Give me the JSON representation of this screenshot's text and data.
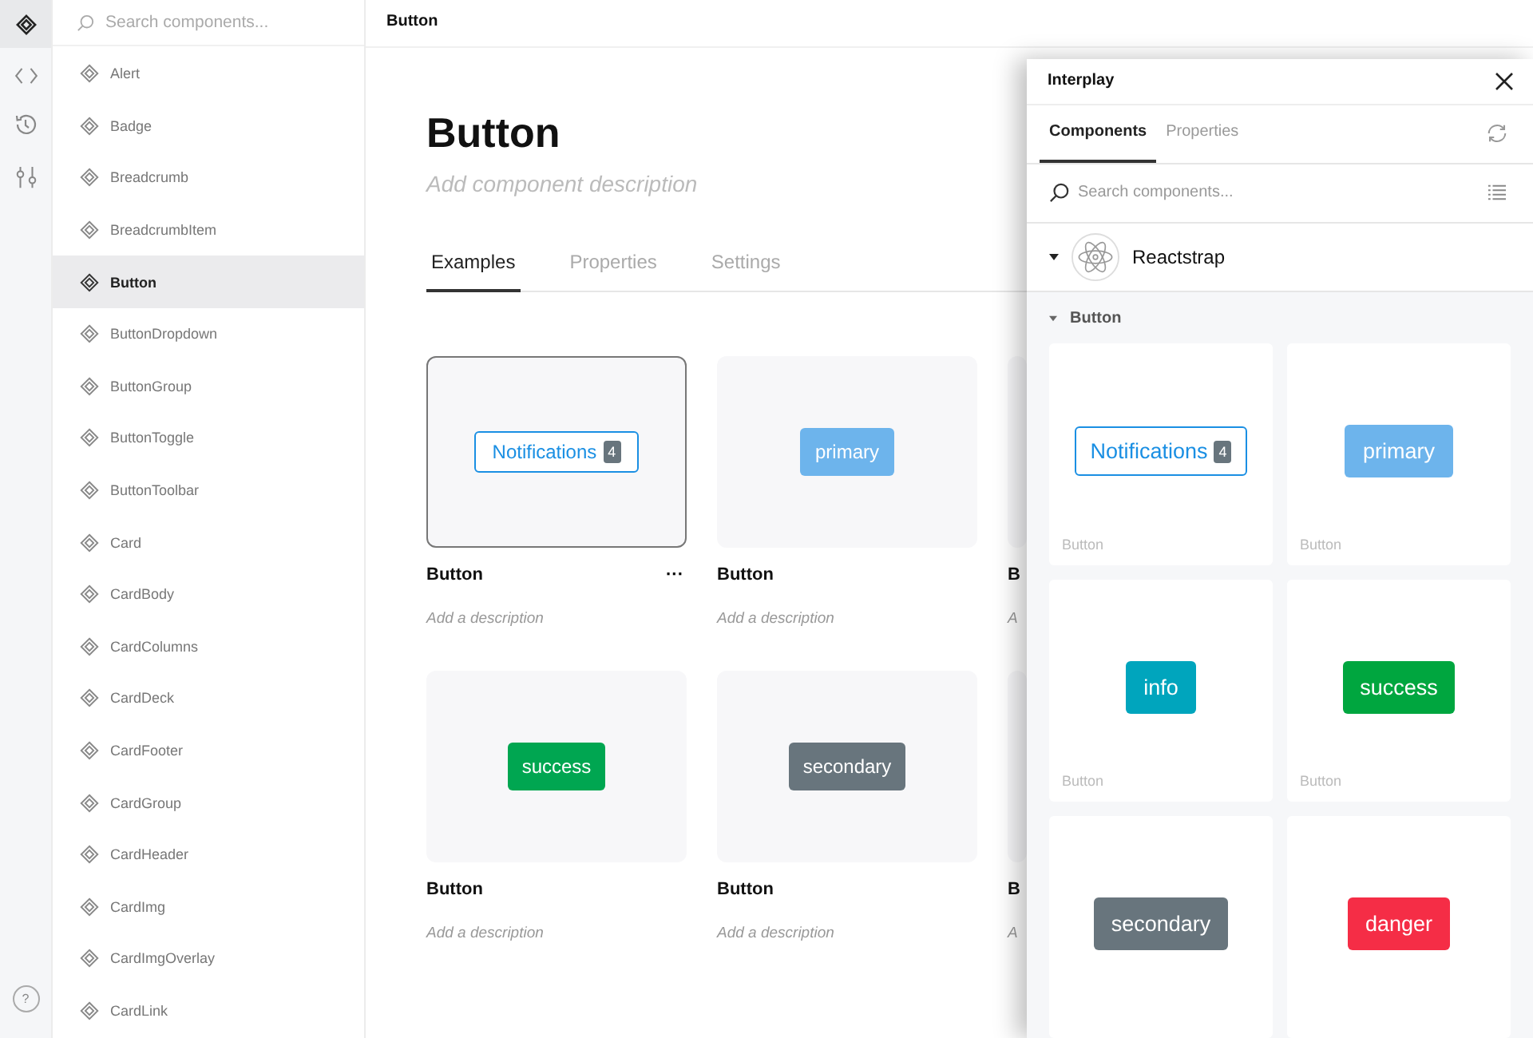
{
  "sidebar": {
    "search": {
      "placeholder": "Search components..."
    },
    "items": [
      {
        "label": "Alert",
        "selected": false
      },
      {
        "label": "Badge",
        "selected": false
      },
      {
        "label": "Breadcrumb",
        "selected": false
      },
      {
        "label": "BreadcrumbItem",
        "selected": false
      },
      {
        "label": "Button",
        "selected": true
      },
      {
        "label": "ButtonDropdown",
        "selected": false
      },
      {
        "label": "ButtonGroup",
        "selected": false
      },
      {
        "label": "ButtonToggle",
        "selected": false
      },
      {
        "label": "ButtonToolbar",
        "selected": false
      },
      {
        "label": "Card",
        "selected": false
      },
      {
        "label": "CardBody",
        "selected": false
      },
      {
        "label": "CardColumns",
        "selected": false
      },
      {
        "label": "CardDeck",
        "selected": false
      },
      {
        "label": "CardFooter",
        "selected": false
      },
      {
        "label": "CardGroup",
        "selected": false
      },
      {
        "label": "CardHeader",
        "selected": false
      },
      {
        "label": "CardImg",
        "selected": false
      },
      {
        "label": "CardImgOverlay",
        "selected": false
      },
      {
        "label": "CardLink",
        "selected": false
      }
    ]
  },
  "rail": {
    "help": "?"
  },
  "main": {
    "breadcrumb": "Button",
    "title": "Button",
    "description": "Add component description",
    "tabs": [
      {
        "label": "Examples",
        "selected": true
      },
      {
        "label": "Properties",
        "selected": false
      },
      {
        "label": "Settings",
        "selected": false
      }
    ],
    "examples": [
      {
        "title": "Button",
        "description": "Add a description",
        "selected": true,
        "menu": "···",
        "button": {
          "kind": "outline-badge",
          "label": "Notifications",
          "badge": "4",
          "color": "#1a8fe3"
        }
      },
      {
        "title": "Button",
        "description": "Add a description",
        "selected": false,
        "button": {
          "kind": "solid",
          "label": "primary",
          "color": "#6db4ec"
        }
      },
      {
        "title": "B",
        "description": "A",
        "selected": false
      },
      {
        "title": "Button",
        "description": "Add a description",
        "selected": false,
        "button": {
          "kind": "solid",
          "label": "success",
          "color": "#00a651"
        }
      },
      {
        "title": "Button",
        "description": "Add a description",
        "selected": false,
        "button": {
          "kind": "solid",
          "label": "secondary",
          "color": "#68757d"
        }
      },
      {
        "title": "B",
        "description": "A",
        "selected": false
      }
    ]
  },
  "panel": {
    "title": "Interplay",
    "tabs": [
      {
        "label": "Components",
        "selected": true
      },
      {
        "label": "Properties",
        "selected": false
      }
    ],
    "search": {
      "placeholder": "Search components..."
    },
    "library": {
      "name": "Reactstrap",
      "expanded": true
    },
    "section": {
      "name": "Button",
      "expanded": true
    },
    "cards": [
      {
        "label": "Button",
        "button": {
          "kind": "outline-badge",
          "label": "Notifications",
          "badge": "4",
          "color": "#1a8fe3"
        }
      },
      {
        "label": "Button",
        "button": {
          "kind": "solid",
          "label": "primary",
          "color": "#6db4ec"
        }
      },
      {
        "label": "Button",
        "button": {
          "kind": "solid",
          "label": "info",
          "color": "#00a5bd"
        }
      },
      {
        "label": "Button",
        "button": {
          "kind": "solid",
          "label": "success",
          "color": "#00a63f"
        }
      },
      {
        "button": {
          "kind": "solid",
          "label": "secondary",
          "color": "#68757d"
        }
      },
      {
        "button": {
          "kind": "solid",
          "label": "danger",
          "color": "#f52d46"
        }
      }
    ]
  }
}
